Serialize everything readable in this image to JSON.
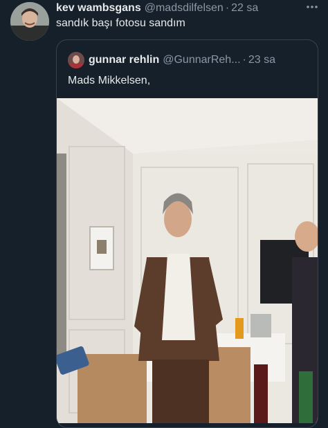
{
  "tweet": {
    "author_name": "kev wambsgans",
    "author_handle": "@madsdilfelsen",
    "separator": "·",
    "time": "22 sa",
    "text": "sandık başı fotosu sandım",
    "more_icon": "more-horizontal-icon"
  },
  "quoted": {
    "author_name": "gunnar rehlin",
    "author_handle": "@GunnarReh...",
    "separator": "·",
    "time": "23 sa",
    "text": "Mads Mikkelsen,"
  },
  "colors": {
    "background": "#15202b",
    "text": "#e7e9ea",
    "secondary": "#8b98a5",
    "border": "#38444d"
  }
}
